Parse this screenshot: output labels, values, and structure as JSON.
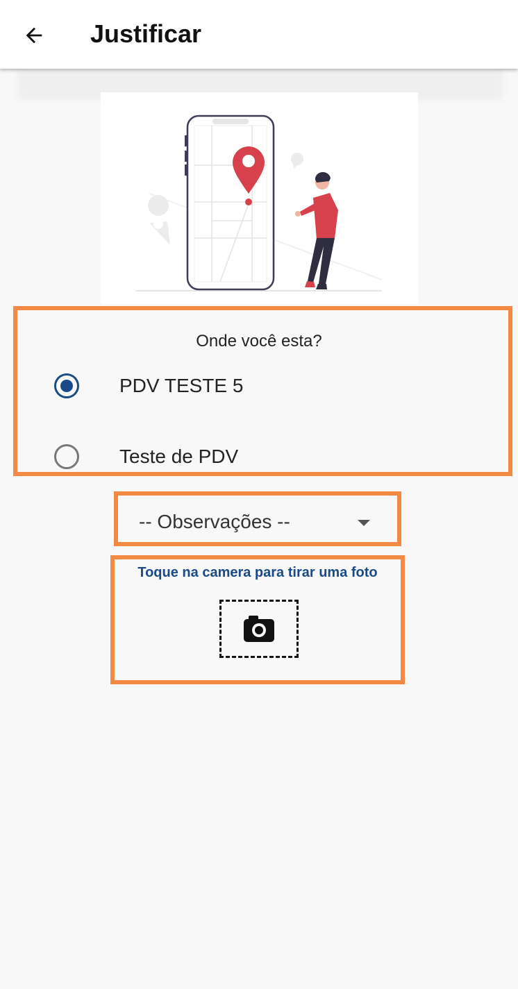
{
  "header": {
    "title": "Justificar",
    "back_icon": "arrow-left-icon"
  },
  "location": {
    "question": "Onde você esta?",
    "options": [
      {
        "label": "PDV TESTE 5",
        "selected": true
      },
      {
        "label": "Teste de PDV",
        "selected": false
      }
    ]
  },
  "observations": {
    "selected_label": "-- Observações --"
  },
  "camera": {
    "hint": "Toque na camera para tirar uma foto",
    "icon": "camera-icon"
  },
  "colors": {
    "accent": "#1a4a8a",
    "highlight": "#f28a43",
    "pin": "#d7414c"
  }
}
